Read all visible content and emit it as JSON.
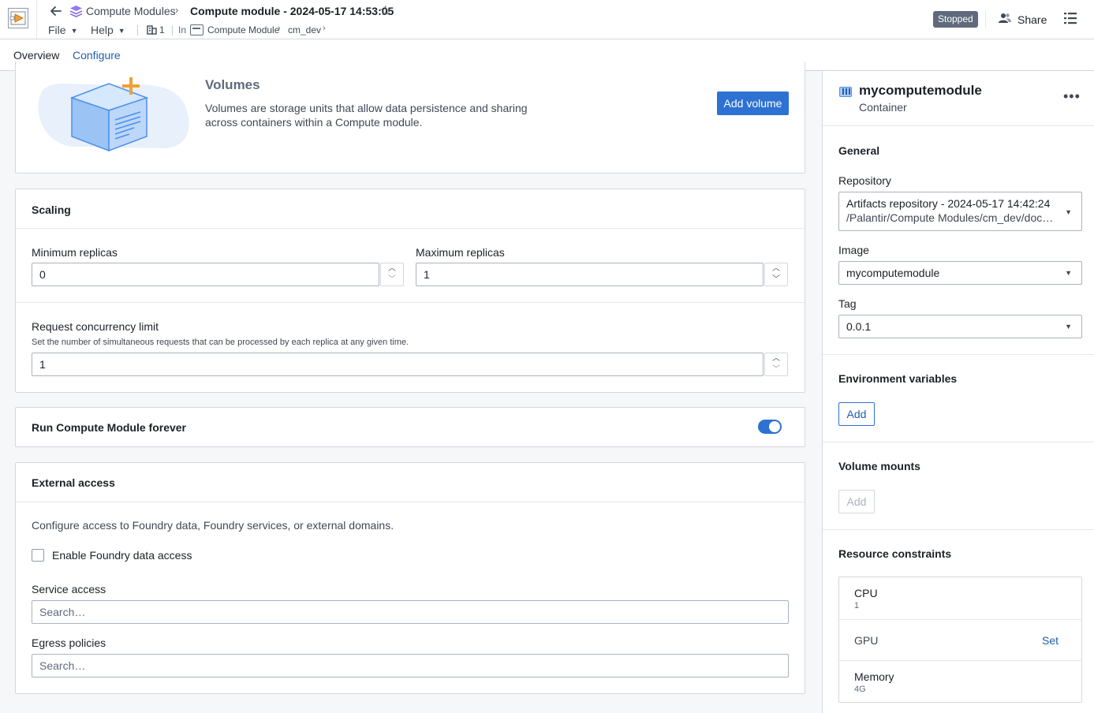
{
  "header": {
    "breadcrumb_parent": "Compute Modules",
    "title": "Compute module - 2024-05-17 14:53:05",
    "menus": {
      "file": "File",
      "help": "Help"
    },
    "org_count": "1",
    "location_prefix": "In",
    "path": [
      "Compute Module",
      "cm_dev"
    ],
    "status": "Stopped",
    "share_label": "Share"
  },
  "tabs": [
    {
      "label": "Overview",
      "active": false
    },
    {
      "label": "Configure",
      "active": true
    }
  ],
  "volumes": {
    "title": "Volumes",
    "description": "Volumes are storage units that allow data persistence and sharing across containers within a Compute module.",
    "add_label": "Add volume"
  },
  "scaling": {
    "title": "Scaling",
    "min_label": "Minimum replicas",
    "min_value": "0",
    "max_label": "Maximum replicas",
    "max_value": "1",
    "concurrency_label": "Request concurrency limit",
    "concurrency_help": "Set the number of simultaneous requests that can be processed by each replica at any given time.",
    "concurrency_value": "1"
  },
  "forever": {
    "title": "Run Compute Module forever",
    "enabled": true
  },
  "external": {
    "title": "External access",
    "description": "Configure access to Foundry data, Foundry services, or external domains.",
    "data_access_label": "Enable Foundry data access",
    "service_label": "Service access",
    "service_placeholder": "Search…",
    "egress_label": "Egress policies",
    "egress_placeholder": "Search…"
  },
  "panel": {
    "name": "mycomputemodule",
    "kind": "Container",
    "general_title": "General",
    "repository_label": "Repository",
    "repository_value": "Artifacts repository - 2024-05-17 14:42:24",
    "repository_path": "/Palantir/Compute Modules/cm_dev/docs/…",
    "image_label": "Image",
    "image_value": "mycomputemodule",
    "tag_label": "Tag",
    "tag_value": "0.0.1",
    "env_title": "Environment variables",
    "env_add": "Add",
    "mounts_title": "Volume mounts",
    "mounts_add": "Add",
    "resources_title": "Resource constraints",
    "resources": [
      {
        "name": "CPU",
        "value": "1"
      },
      {
        "name": "GPU",
        "action": "Set"
      },
      {
        "name": "Memory",
        "value": "4G"
      }
    ]
  },
  "colors": {
    "primary": "#2d72d2",
    "status_badge": "#5f6b7c"
  }
}
